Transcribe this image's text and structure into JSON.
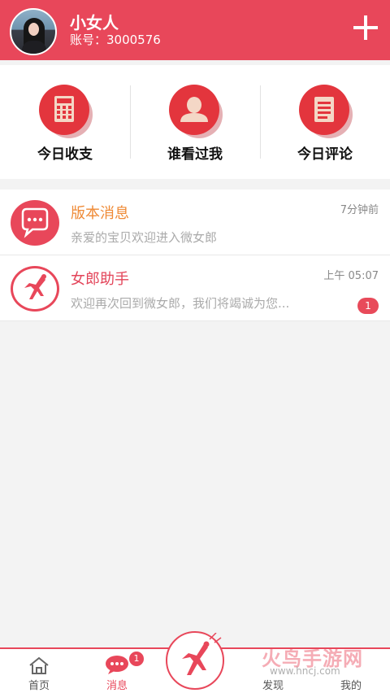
{
  "header": {
    "user_name": "小女人",
    "account": "账号：3000576"
  },
  "quick_actions": [
    {
      "label": "今日收支",
      "icon": "calculator-icon"
    },
    {
      "label": "谁看过我",
      "icon": "person-icon"
    },
    {
      "label": "今日评论",
      "icon": "document-icon"
    }
  ],
  "messages": [
    {
      "title": "版本消息",
      "title_color": "#ef8a36",
      "subtitle": "亲爱的宝贝欢迎进入微女郎",
      "time": "7分钟前",
      "icon": "chat-bubble-icon"
    },
    {
      "title": "女郎助手",
      "title_color": "#e3455a",
      "subtitle": "欢迎再次回到微女郎，我们将竭诚为您...",
      "time": "上午 05:07",
      "badge": "1",
      "icon": "dancer-icon"
    }
  ],
  "tabbar": {
    "home": "首页",
    "messages": "消息",
    "messages_badge": "1",
    "discover": "发现",
    "mine": "我的"
  },
  "watermark": {
    "text": "火鸟手游网",
    "url": "www.hncj.com"
  },
  "colors": {
    "brand": "#e8475a",
    "icon_red": "#e3353d"
  }
}
